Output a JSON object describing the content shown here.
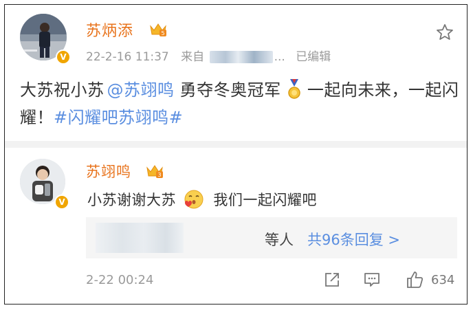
{
  "post": {
    "author": "苏炳添",
    "timestamp": "22-2-16 11:37",
    "source_prefix": "来自",
    "source_suffix": "...",
    "edited": "已编辑",
    "text_before": "大苏祝小苏",
    "mention": "@苏翊鸣",
    "text_middle": " 勇夺冬奥冠军",
    "text_after": "一起向未来，一起闪耀！",
    "hashtag": "#闪耀吧苏翊鸣#",
    "icons": [
      "verified-badge-icon",
      "vip-crown-icon",
      "star-icon",
      "medal-icon"
    ]
  },
  "reply": {
    "author": "苏翊鸣",
    "text_before": "小苏谢谢大苏",
    "text_after": "我们一起闪耀吧",
    "replies_prefix": "等人",
    "replies_link": "共96条回复 >",
    "time": "2-22 00:24",
    "like_count": "634",
    "icons": [
      "verified-badge-icon",
      "vip-crown-icon",
      "blowing-kiss-emoji-icon",
      "share-icon",
      "comment-icon",
      "thumbs-up-icon"
    ]
  },
  "colors": {
    "name_orange": "#e8731c",
    "link_blue": "#5a8ee0",
    "meta_gray": "#9a9a9a",
    "badge_gold": "#f0a500"
  }
}
